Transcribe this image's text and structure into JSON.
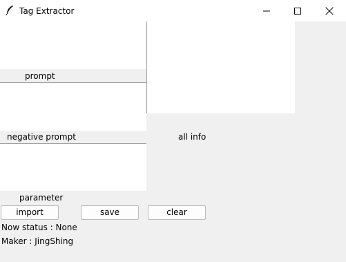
{
  "window": {
    "title": "Tag Extractor",
    "app_icon": "feather-icon",
    "controls": [
      "minimize-icon",
      "maximize-icon",
      "close-icon"
    ]
  },
  "fields": {
    "prompt": {
      "label": "prompt",
      "value": ""
    },
    "negative_prompt": {
      "label": "negative prompt",
      "value": ""
    },
    "parameter": {
      "label": "parameter",
      "value": ""
    },
    "all_info": {
      "label": "all info",
      "value": ""
    }
  },
  "buttons": {
    "import": "import",
    "save": "save",
    "clear": "clear"
  },
  "status": "Now status : None",
  "maker": "Maker : JingShing",
  "colors": {
    "window_bg": "#f0f0f0",
    "textbox_bg": "#ffffff",
    "titlebar_bg": "#ffffff"
  }
}
